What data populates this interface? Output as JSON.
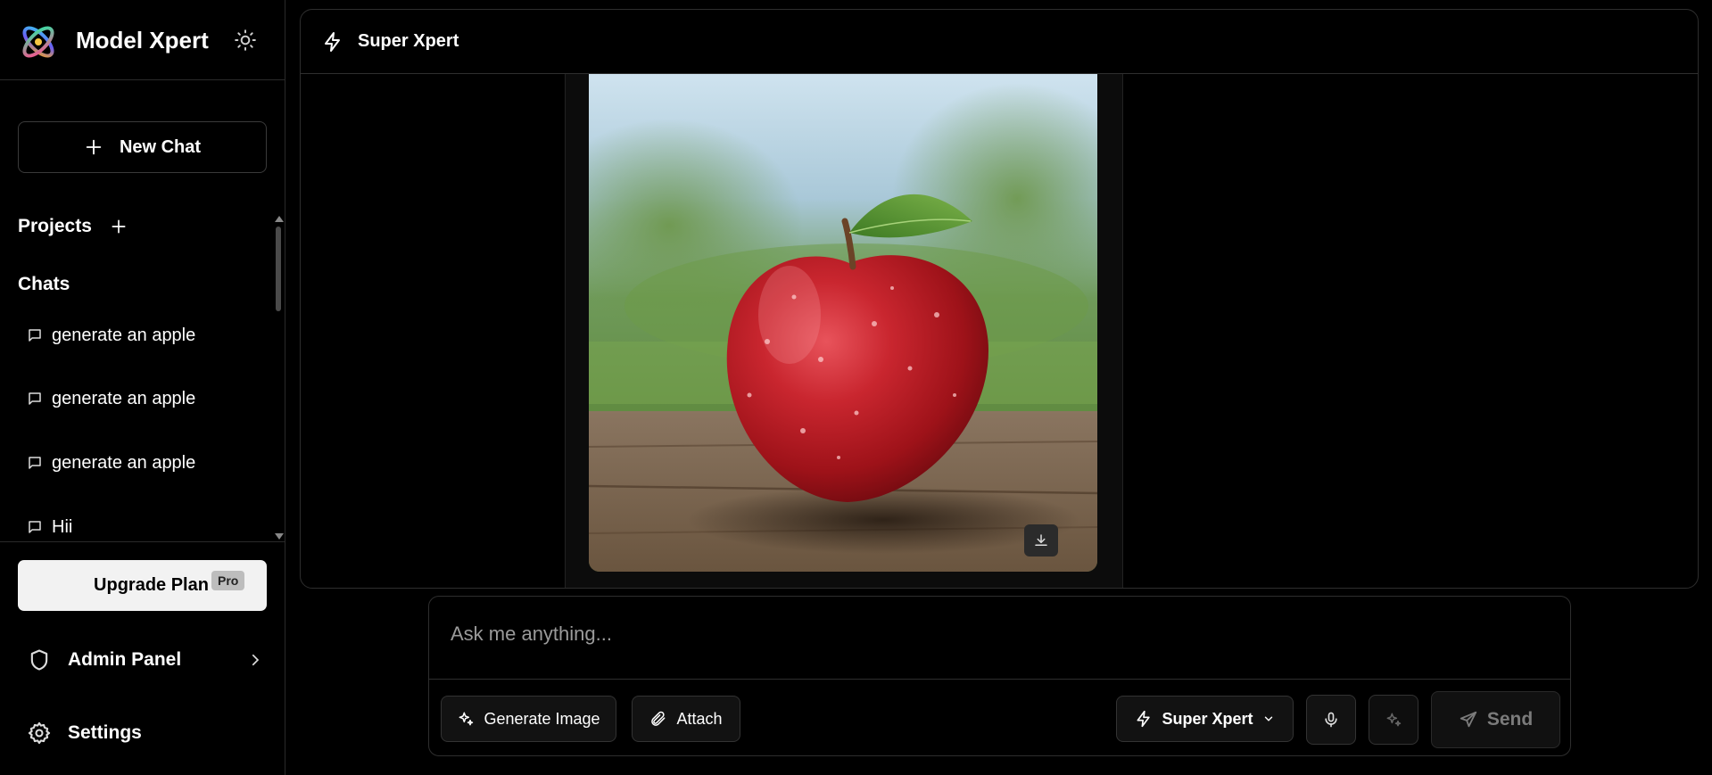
{
  "app": {
    "name": "Model Xpert"
  },
  "sidebar": {
    "new_chat_label": "New Chat",
    "projects_label": "Projects",
    "chats_label": "Chats",
    "chats": [
      {
        "label": "generate an apple"
      },
      {
        "label": "generate an apple"
      },
      {
        "label": "generate an apple"
      },
      {
        "label": "Hii"
      }
    ],
    "upgrade_label": "Upgrade Plan",
    "pro_badge": "Pro",
    "admin_label": "Admin Panel",
    "settings_label": "Settings"
  },
  "main": {
    "header_title": "Super Xpert"
  },
  "composer": {
    "placeholder": "Ask me anything...",
    "generate_image_label": "Generate Image",
    "attach_label": "Attach",
    "model_label": "Super Xpert",
    "send_label": "Send"
  },
  "icons": {
    "logo": "model-xpert-logo",
    "theme": "sun-icon",
    "new_chat": "plus-icon",
    "add_project": "plus-icon",
    "chat": "message-square-icon",
    "admin": "shield-icon",
    "admin_arrow": "chevron-right-icon",
    "settings": "gear-icon",
    "header": "lightning-icon",
    "download": "download-icon",
    "generate": "sparkles-icon",
    "attach": "paperclip-icon",
    "model": "lightning-icon",
    "model_dropdown": "chevron-down-icon",
    "mic": "microphone-icon",
    "enhance": "sparkles-icon",
    "send": "send-icon"
  },
  "colors": {
    "background": "#000000",
    "border": "#2e2e2e",
    "upgrade_bg": "#f2f2f2",
    "send_disabled_text": "#7b7b7b"
  }
}
